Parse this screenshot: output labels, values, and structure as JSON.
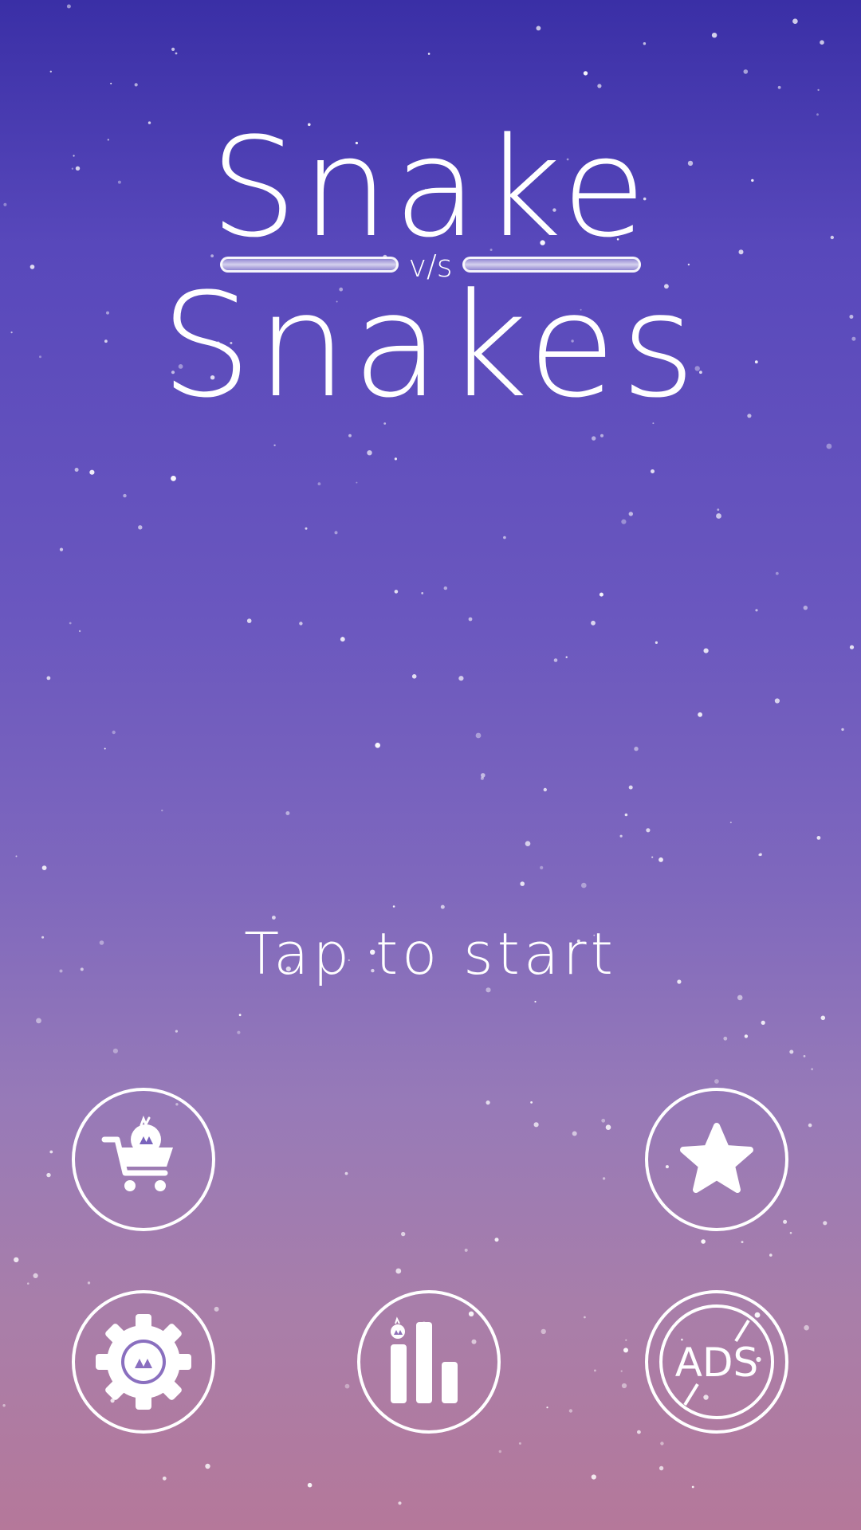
{
  "title": {
    "line1": "Snake",
    "connector": "v/s",
    "line2": "Snakes"
  },
  "prompt": "Tap to start",
  "buttons": {
    "shop": {
      "icon": "shopping-cart-icon"
    },
    "rate": {
      "icon": "star-icon"
    },
    "settings": {
      "icon": "gear-icon"
    },
    "leaderboard": {
      "icon": "bar-chart-icon"
    },
    "no_ads": {
      "icon": "no-ads-icon",
      "label": "ADS"
    }
  },
  "colors": {
    "background_top": "#3a2fa6",
    "background_bottom": "#b5789a",
    "foreground": "#ffffff"
  }
}
